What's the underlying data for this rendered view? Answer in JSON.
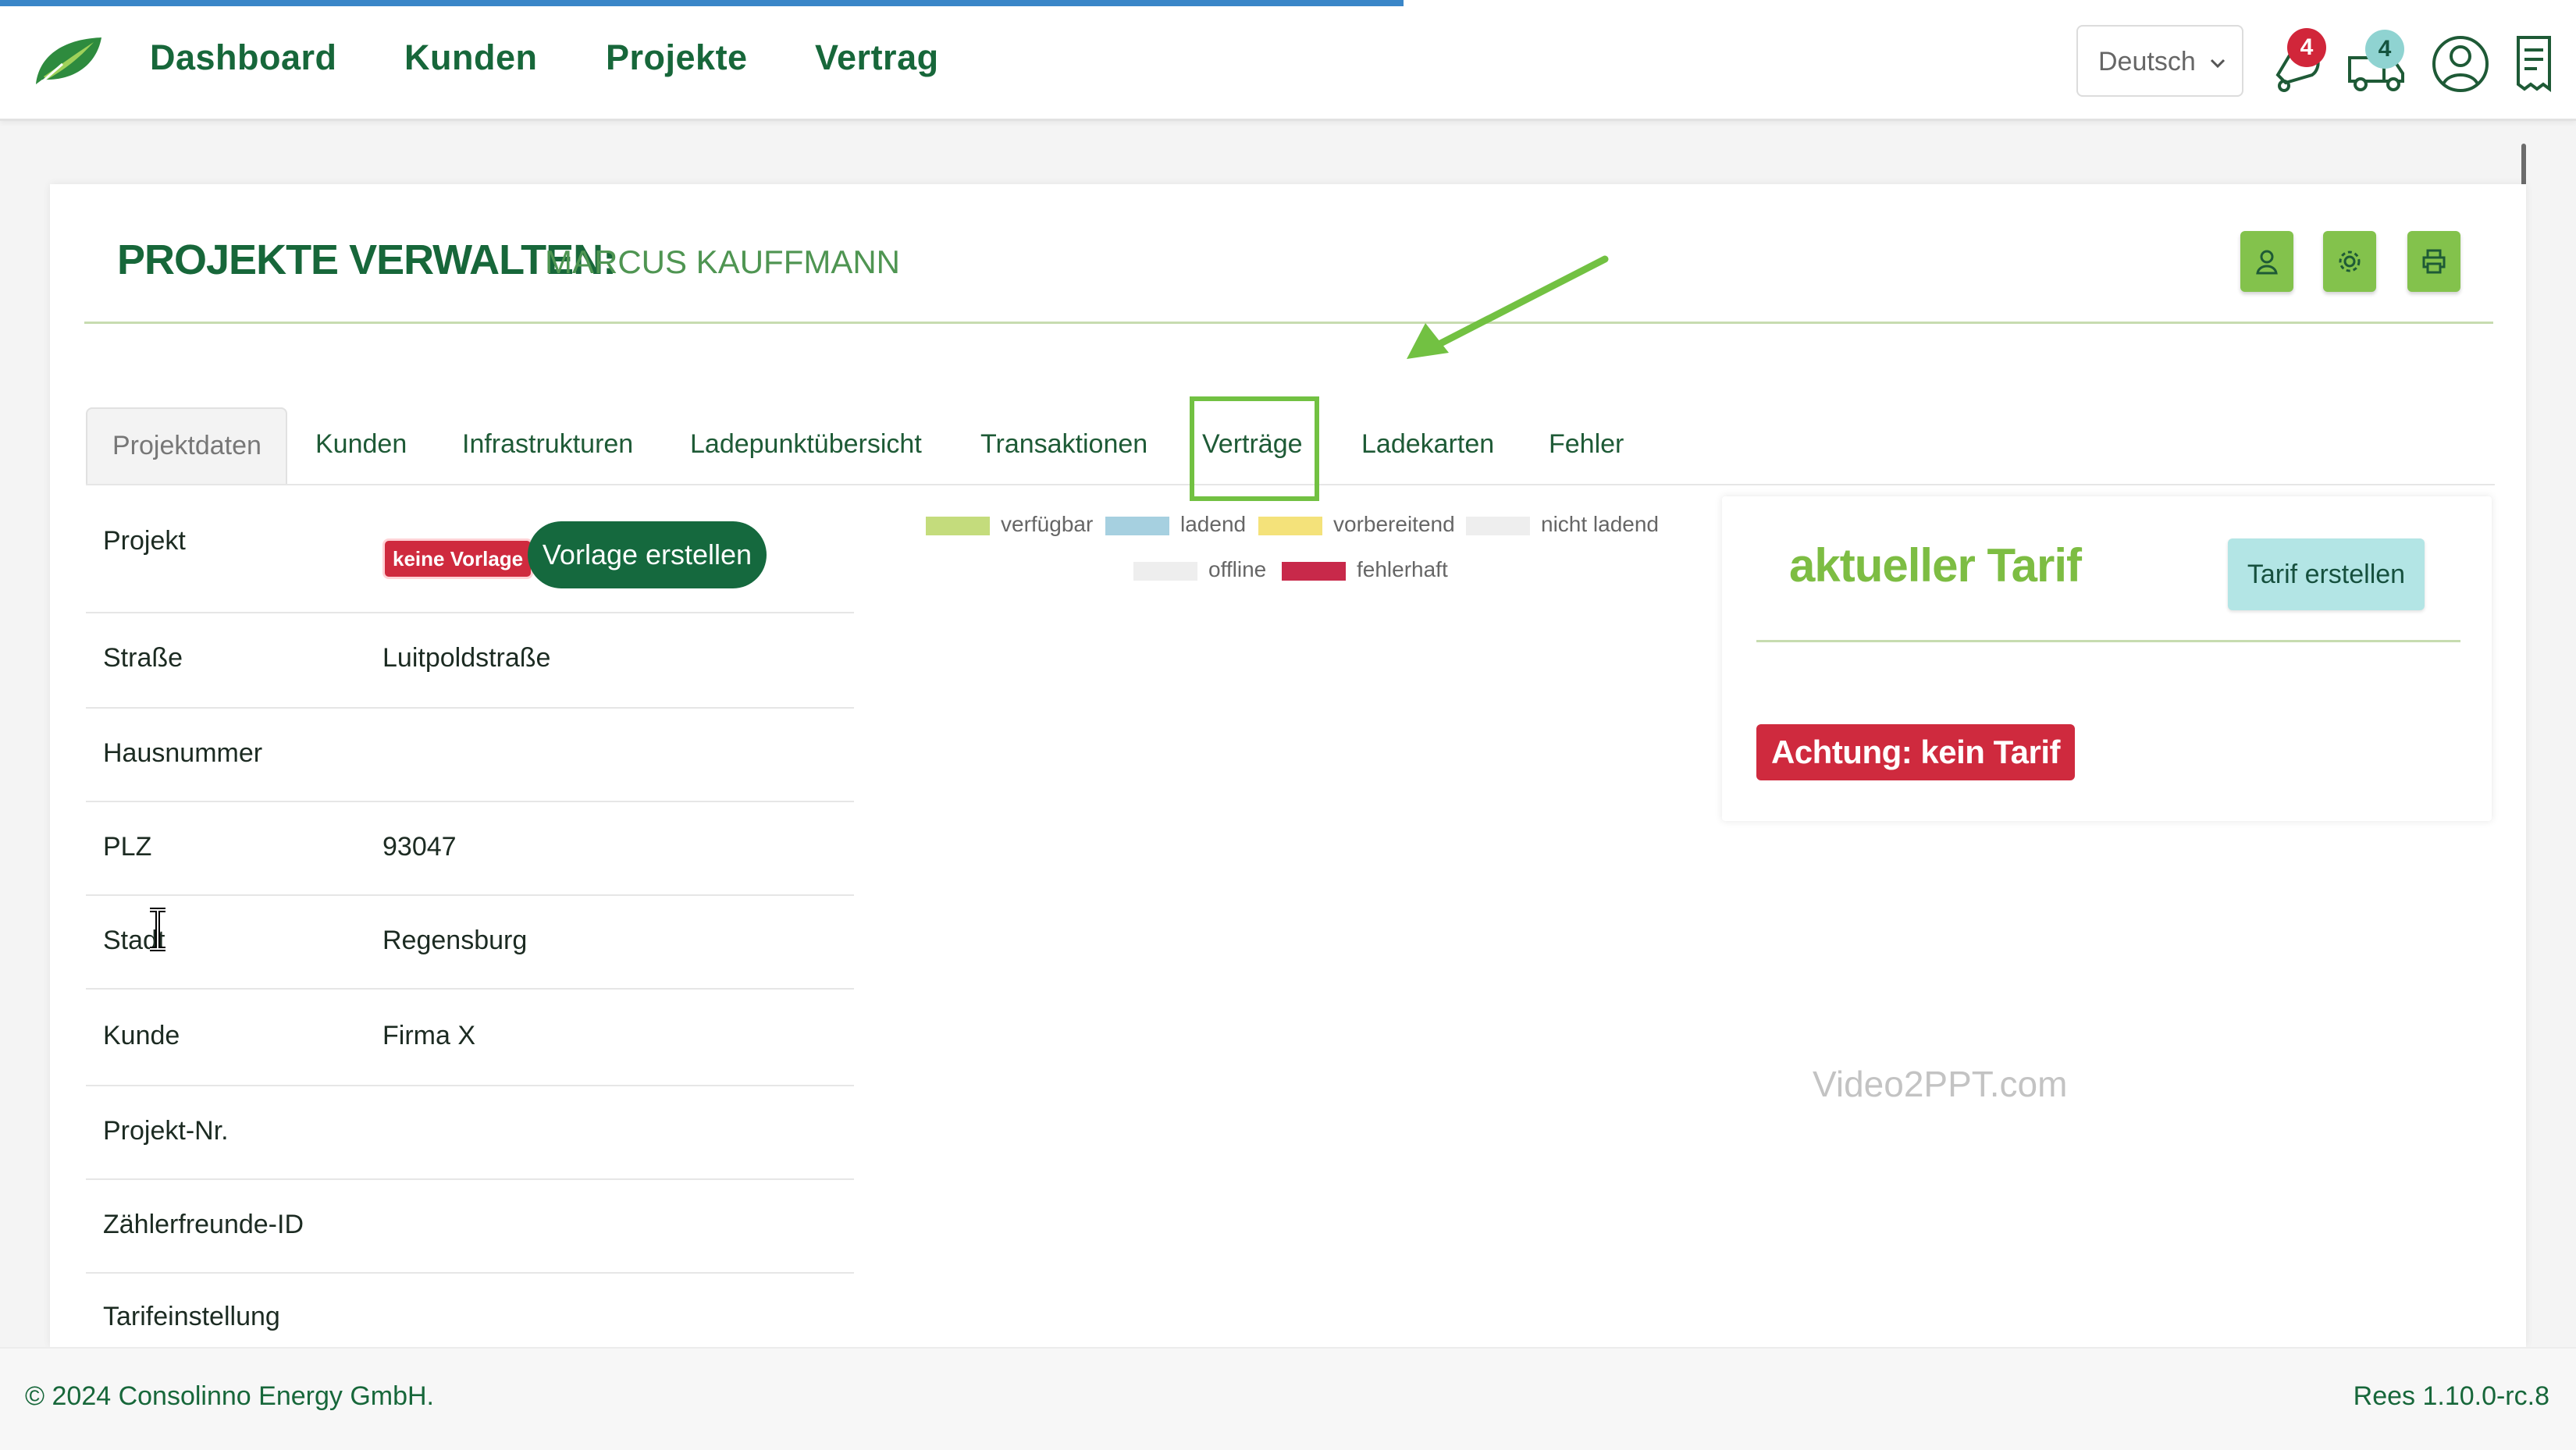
{
  "nav": {
    "items": [
      "Dashboard",
      "Kunden",
      "Projekte",
      "Vertrag"
    ],
    "language": "Deutsch",
    "notification_count": "4",
    "message_count": "4",
    "icons": [
      "leaf-logo-icon",
      "bell-icon",
      "truck-icon",
      "user-circle-icon",
      "receipt-icon"
    ]
  },
  "header": {
    "title": "PROJEKTE VERWALTEN:",
    "subtitle": "MARCUS KAUFFMANN",
    "actions": [
      "user-icon",
      "gear-icon",
      "printer-icon"
    ]
  },
  "tabs": [
    {
      "label": "Projektdaten",
      "active": true
    },
    {
      "label": "Kunden"
    },
    {
      "label": "Infrastrukturen"
    },
    {
      "label": "Ladepunktübersicht"
    },
    {
      "label": "Transaktionen"
    },
    {
      "label": "Verträge",
      "highlighted": true
    },
    {
      "label": "Ladekarten"
    },
    {
      "label": "Fehler"
    }
  ],
  "project_table": {
    "rows": [
      {
        "label": "Projekt",
        "value": ""
      },
      {
        "label": "Straße",
        "value": "Luitpoldstraße"
      },
      {
        "label": "Hausnummer",
        "value": ""
      },
      {
        "label": "PLZ",
        "value": "93047"
      },
      {
        "label": "Stadt",
        "value": "Regensburg"
      },
      {
        "label": "Kunde",
        "value": "Firma X"
      },
      {
        "label": "Projekt-Nr.",
        "value": ""
      },
      {
        "label": "Zählerfreunde-ID",
        "value": ""
      },
      {
        "label": "Tarifeinstellung",
        "value": ""
      }
    ],
    "no_template_badge": "keine Vorlage",
    "create_template_button": "Vorlage erstellen"
  },
  "legend": {
    "items": [
      {
        "label": "verfügbar",
        "color": "#c4dc7c"
      },
      {
        "label": "ladend",
        "color": "#a6d0e0"
      },
      {
        "label": "vorbereitend",
        "color": "#f4e27a"
      },
      {
        "label": "nicht ladend",
        "color": "#eeeeee"
      },
      {
        "label": "offline",
        "color": "#eeeeee"
      },
      {
        "label": "fehlerhaft",
        "color": "#c8294a"
      }
    ]
  },
  "tarif": {
    "title": "aktueller Tarif",
    "create_button": "Tarif erstellen",
    "alert": "Achtung: kein Tarif"
  },
  "watermark": "Video2PPT.com",
  "footer": {
    "copyright": "© 2024 Consolinno Energy GmbH.",
    "version": "Rees 1.10.0-rc.8"
  },
  "colors": {
    "brand_green": "#17673a",
    "accent_green": "#83c24c",
    "alert_red": "#cf2a3e",
    "highlight_green": "#72c142"
  }
}
